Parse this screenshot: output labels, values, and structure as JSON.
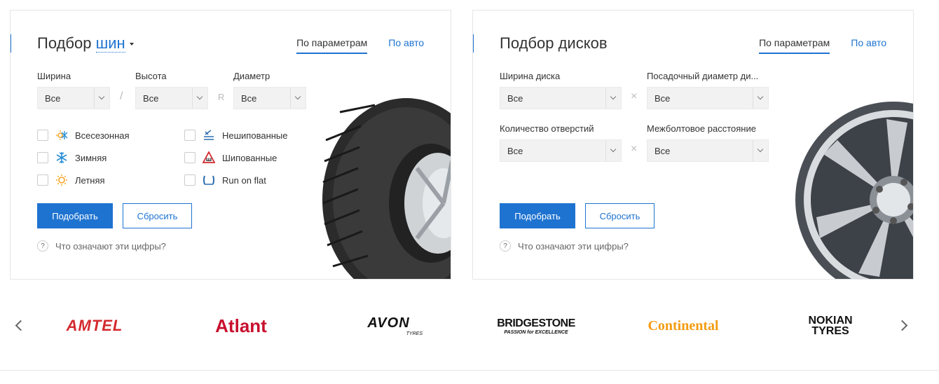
{
  "tires": {
    "title_prefix": "Подбор",
    "title_link": "шин",
    "tabs": [
      "По параметрам",
      "По авто"
    ],
    "fields": [
      {
        "label": "Ширина",
        "value": "Все"
      },
      {
        "label": "Высота",
        "value": "Все"
      },
      {
        "label": "Диаметр",
        "value": "Все"
      }
    ],
    "separators": [
      "/",
      "R"
    ],
    "checks_left": [
      {
        "label": "Всесезонная",
        "icon": "all-season-icon"
      },
      {
        "label": "Зимняя",
        "icon": "snowflake-icon"
      },
      {
        "label": "Летняя",
        "icon": "sun-icon"
      }
    ],
    "checks_right": [
      {
        "label": "Нешипованные",
        "icon": "non-studded-icon"
      },
      {
        "label": "Шипованные",
        "icon": "studded-icon"
      },
      {
        "label": "Run on flat",
        "icon": "run-flat-icon"
      }
    ],
    "submit_label": "Подобрать",
    "reset_label": "Сбросить",
    "help_text": "Что означают эти цифры?"
  },
  "disks": {
    "title": "Подбор дисков",
    "tabs": [
      "По параметрам",
      "По авто"
    ],
    "fields": [
      {
        "label": "Ширина диска",
        "value": "Все"
      },
      {
        "label": "Посадочный диаметр ди...",
        "value": "Все"
      },
      {
        "label": "Количество отверстий",
        "value": "Все"
      },
      {
        "label": "Межболтовое расстояние",
        "value": "Все"
      }
    ],
    "separator": "×",
    "submit_label": "Подобрать",
    "reset_label": "Сбросить",
    "help_text": "Что означают эти цифры?"
  },
  "brands": [
    "AMTEL",
    "Atlant",
    "AVON",
    "BRIDGESTONE",
    "Continental",
    "NOKIAN TYRES"
  ],
  "brand_sublines": {
    "avon": "TYRES",
    "bridgestone": "PASSION for EXCELLENCE"
  },
  "colors": {
    "accent": "#1e73d0",
    "amtel": "#d42a2f",
    "atlant": "#c8102e",
    "continental": "#f39c12"
  }
}
